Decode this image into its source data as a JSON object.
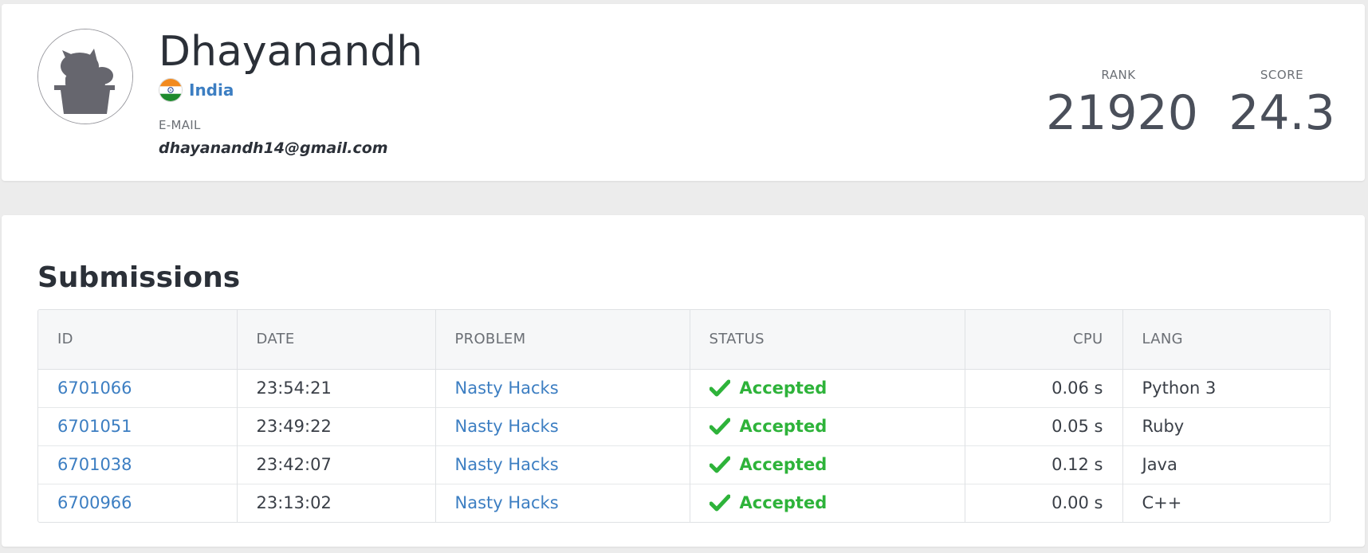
{
  "profile": {
    "name": "Dhayanandh",
    "country": "India",
    "email_label": "E-MAIL",
    "email": "dhayanandh14@gmail.com",
    "rank_label": "RANK",
    "rank": "21920",
    "score_label": "SCORE",
    "score": "24.3",
    "avatar_icon": "cat-avatar-icon",
    "flag_icon": "india-flag-icon"
  },
  "submissions": {
    "title": "Submissions",
    "columns": {
      "id": "ID",
      "date": "DATE",
      "problem": "PROBLEM",
      "status": "STATUS",
      "cpu": "CPU",
      "lang": "LANG"
    },
    "rows": [
      {
        "id": "6701066",
        "date": "23:54:21",
        "problem": "Nasty Hacks",
        "status": "Accepted",
        "cpu": "0.06 s",
        "lang": "Python 3"
      },
      {
        "id": "6701051",
        "date": "23:49:22",
        "problem": "Nasty Hacks",
        "status": "Accepted",
        "cpu": "0.05 s",
        "lang": "Ruby"
      },
      {
        "id": "6701038",
        "date": "23:42:07",
        "problem": "Nasty Hacks",
        "status": "Accepted",
        "cpu": "0.12 s",
        "lang": "Java"
      },
      {
        "id": "6700966",
        "date": "23:13:02",
        "problem": "Nasty Hacks",
        "status": "Accepted",
        "cpu": "0.00 s",
        "lang": "C++"
      }
    ]
  },
  "colors": {
    "link": "#3c7ec2",
    "accepted": "#2eb33a",
    "background": "#ececec"
  }
}
